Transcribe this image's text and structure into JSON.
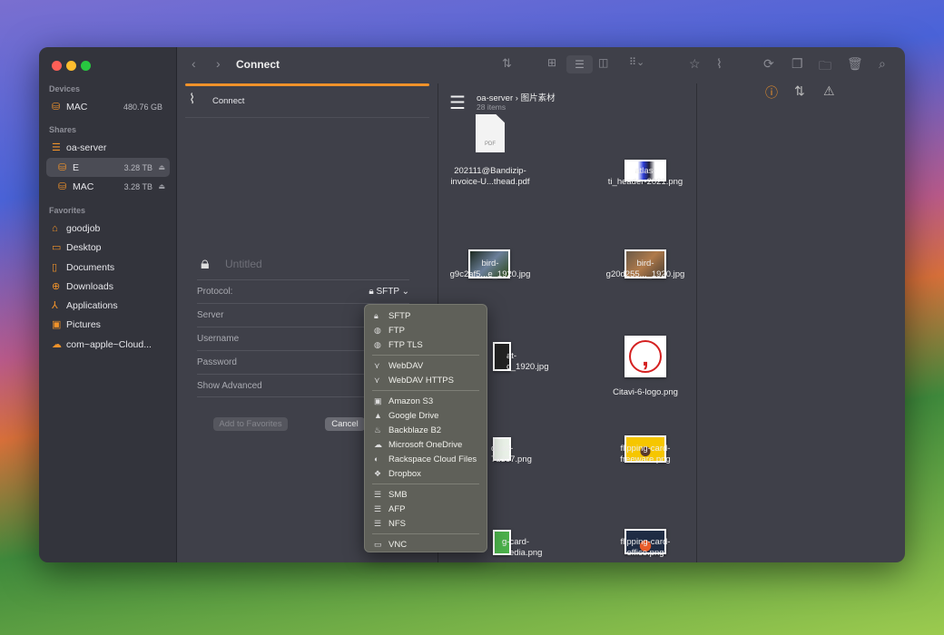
{
  "window": {
    "title": "Connect"
  },
  "sidebar": {
    "sections": [
      {
        "title": "Devices",
        "items": [
          {
            "label": "MAC",
            "size": "480.76 GB",
            "icon": "drive-icon"
          }
        ]
      },
      {
        "title": "Shares",
        "items": [
          {
            "label": "oa-server",
            "icon": "server-icon"
          },
          {
            "label": "E",
            "size": "3.28 TB",
            "icon": "drive-icon",
            "selected": true
          },
          {
            "label": "MAC",
            "size": "3.28 TB",
            "icon": "drive-icon"
          }
        ]
      },
      {
        "title": "Favorites",
        "items": [
          {
            "label": "goodjob",
            "icon": "home-icon"
          },
          {
            "label": "Desktop",
            "icon": "desktop-icon"
          },
          {
            "label": "Documents",
            "icon": "document-icon"
          },
          {
            "label": "Downloads",
            "icon": "download-icon"
          },
          {
            "label": "Applications",
            "icon": "applications-icon"
          },
          {
            "label": "Pictures",
            "icon": "pictures-icon"
          },
          {
            "label": "com~apple~Cloud...",
            "icon": "cloud-icon"
          }
        ]
      }
    ]
  },
  "connect": {
    "tab_label": "Connect",
    "name_placeholder": "Untitled",
    "protocol_label": "Protocol:",
    "protocol_value": "SFTP",
    "fields": [
      "Server",
      "Username",
      "Password",
      "Show Advanced"
    ],
    "add_favorites": "Add to Favorites",
    "cancel": "Cancel"
  },
  "menu": {
    "groups": [
      [
        {
          "label": "SFTP",
          "icon": "lock-icon"
        },
        {
          "label": "FTP",
          "icon": "globe-icon"
        },
        {
          "label": "FTP TLS",
          "icon": "globe-icon"
        }
      ],
      [
        {
          "label": "WebDAV",
          "icon": "network-icon"
        },
        {
          "label": "WebDAV HTTPS",
          "icon": "network-icon"
        }
      ],
      [
        {
          "label": "Amazon S3",
          "icon": "s3-icon"
        },
        {
          "label": "Google Drive",
          "icon": "google-drive-icon"
        },
        {
          "label": "Backblaze B2",
          "icon": "flame-icon"
        },
        {
          "label": "Microsoft OneDrive",
          "icon": "onedrive-icon"
        },
        {
          "label": "Rackspace Cloud Files",
          "icon": "rackspace-icon"
        },
        {
          "label": "Dropbox",
          "icon": "dropbox-icon"
        }
      ],
      [
        {
          "label": "SMB",
          "icon": "server-icon"
        },
        {
          "label": "AFP",
          "icon": "server-icon"
        },
        {
          "label": "NFS",
          "icon": "server-icon"
        }
      ],
      [
        {
          "label": "VNC",
          "icon": "screen-icon"
        }
      ]
    ]
  },
  "browser": {
    "path": [
      "oa-server",
      "图片素材"
    ],
    "count": "28 items",
    "files": [
      {
        "l1": "202111@Bandizip-",
        "l2": "invoice-U...thead.pdf"
      },
      {
        "l1": "atlas-",
        "l2": "ti_header-2021.png"
      },
      {
        "l1": "bird-",
        "l2": "g9c2af5...e_1920.jpg"
      },
      {
        "l1": "bird-",
        "l2": "g20d255..._1920.jpg"
      },
      {
        "l1": "at-",
        "l2": "c_1920.jpg"
      },
      {
        "l1": "Citavi-6-logo.png",
        "l2": ""
      },
      {
        "l1": "d1a8-",
        "l2": "7d367.png"
      },
      {
        "l1": "flipping-card-",
        "l2": "freeware.png"
      },
      {
        "l1": "g-card-",
        "l2": "edia.png"
      },
      {
        "l1": "flipping-card-",
        "l2": "office.png"
      }
    ]
  },
  "colors": {
    "accent": "#f0922a"
  }
}
